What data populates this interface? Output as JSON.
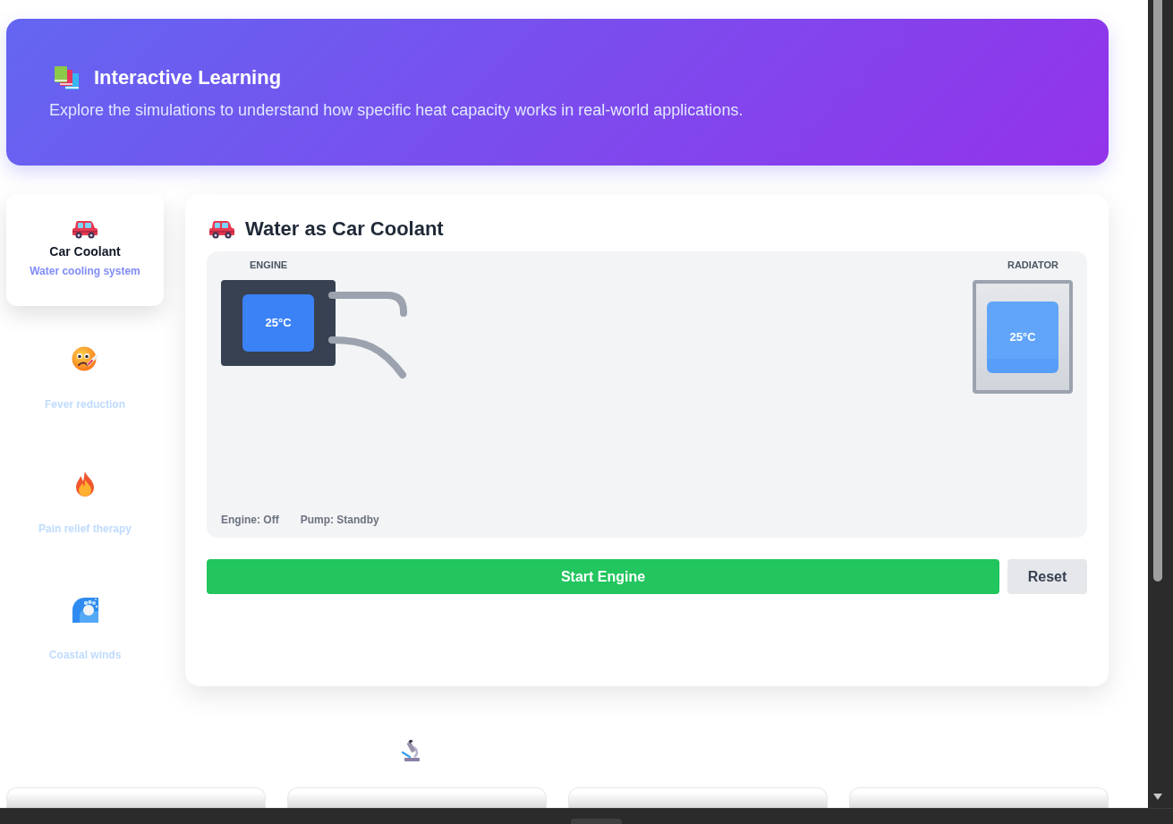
{
  "header": {
    "title": "Interactive Learning",
    "subtitle": "Explore the simulations to understand how specific heat capacity works in real-world applications."
  },
  "sidebar": {
    "items": [
      {
        "title": "Car Coolant",
        "subtitle": "Water cooling system",
        "selected": true
      },
      {
        "subtitle": "Fever reduction",
        "selected": false
      },
      {
        "subtitle": "Pain relief therapy",
        "selected": false
      },
      {
        "subtitle": "Coastal winds",
        "selected": false
      }
    ]
  },
  "simulation": {
    "title": "Water as Car Coolant",
    "engine": {
      "label": "ENGINE",
      "temperature": "25°C"
    },
    "radiator": {
      "label": "RADIATOR",
      "temperature": "25°C"
    },
    "status": [
      "Engine: Off",
      "Pump: Standby"
    ],
    "buttons": [
      {
        "label": "Start Engine",
        "kind": "primary"
      },
      {
        "label": "Reset",
        "kind": "secondary"
      }
    ]
  }
}
